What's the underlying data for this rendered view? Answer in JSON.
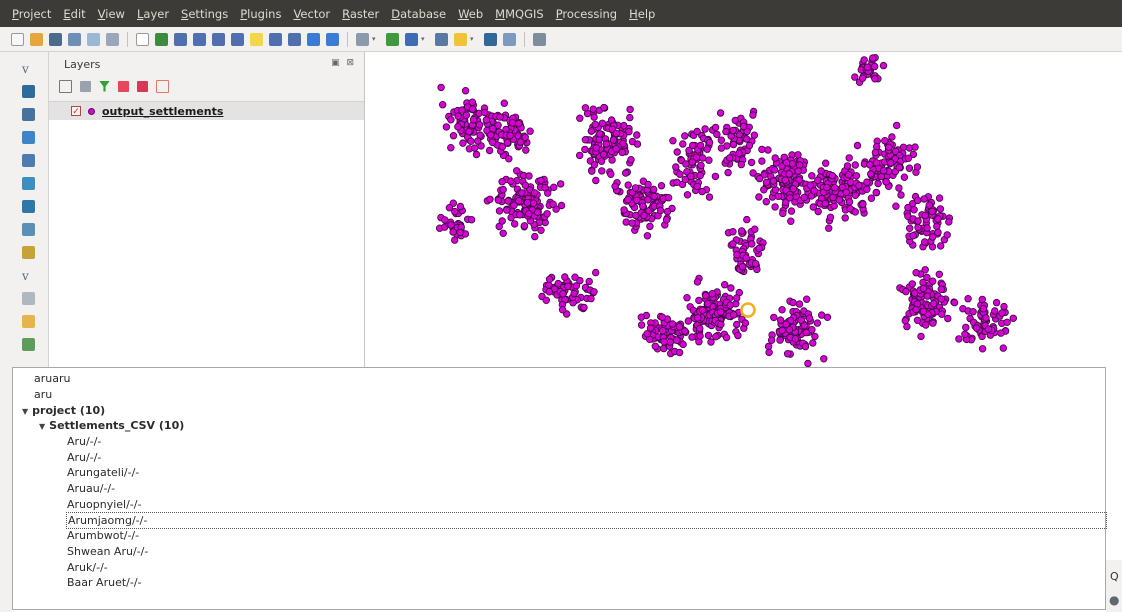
{
  "menu": [
    "Project",
    "Edit",
    "View",
    "Layer",
    "Settings",
    "Plugins",
    "Vector",
    "Raster",
    "Database",
    "Web",
    "MMQGIS",
    "Processing",
    "Help"
  ],
  "panel": {
    "title": "Layers",
    "buttons": "▣ ⊠"
  },
  "layer": {
    "name": "output_settlements",
    "checked_glyph": "✓",
    "symbol_color": "#d400d4"
  },
  "search": {
    "history": [
      "aruaru",
      "aru"
    ],
    "group_project": "project (10)",
    "group_csv": "Settlements_CSV (10)",
    "results": [
      "Aru/-/-",
      "Aru/-/-",
      "Arungateli/-/-",
      "Aruau/-/-",
      "Aruopnyiel/-/-",
      "Arumjaomg/-/-",
      "Arumbwot/-/-",
      "Shwean Aru/-/-",
      "Aruk/-/-",
      "Baar Aruet/-/-"
    ],
    "selected_index": 5
  },
  "glyphs": {
    "expand_arrow": "▼",
    "search_icon": "Q",
    "bubble_icon": "●"
  },
  "colors": {
    "menubar": "#3c3b37",
    "point_fill": "#d400d4",
    "point_stroke": "#3a0a3a",
    "highlight": "#f0b01a"
  },
  "icons": {
    "toolbar": [
      "new-project-icon",
      "open-project-icon",
      "save-project-icon",
      "save-as-icon",
      "print-layout-icon",
      "layout-manager-icon",
      "pan-icon",
      "pan-to-selection-icon",
      "zoom-in-icon",
      "zoom-out-icon",
      "zoom-full-icon",
      "zoom-layer-icon",
      "zoom-selection-icon",
      "zoom-last-icon",
      "zoom-next-icon",
      "refresh-icon",
      "identify-icon",
      "select-icon",
      "measure-icon",
      "attribute-table-icon",
      "statistics-icon",
      "annotation-icon",
      "python-icon",
      "plugin-icon",
      "csv-icon"
    ],
    "left": [
      "add-vector-layer-icon",
      "add-raster-layer-icon",
      "add-postgis-icon",
      "add-spatialite-icon",
      "add-mssql-icon",
      "add-wms-icon",
      "add-wcs-icon",
      "add-wfs-icon",
      "add-delimited-text-icon",
      "new-layer-icon",
      "gps-icon",
      "georeferencer-icon",
      "virtual-layer-icon"
    ]
  }
}
